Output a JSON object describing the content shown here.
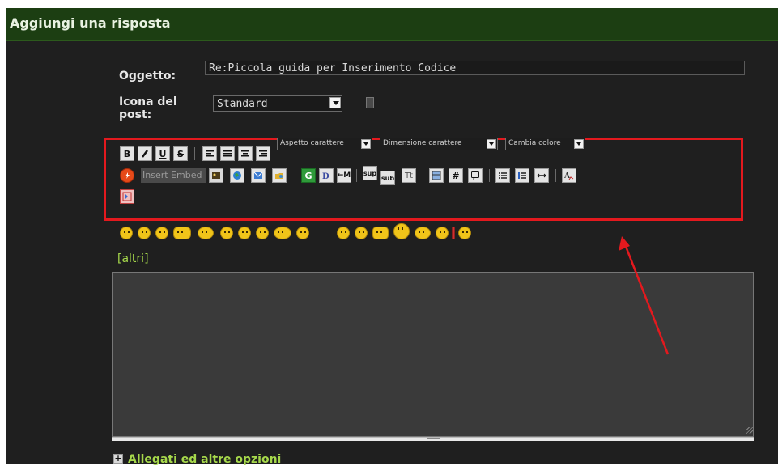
{
  "header": {
    "title": "Aggiungi una risposta"
  },
  "form": {
    "subject_label": "Oggetto:",
    "subject_value": "Re:Piccola guida per Inserimento Codice",
    "icon_label_line1": "Icona del",
    "icon_label_line2": "post:",
    "icon_value": "Standard"
  },
  "toolbar": {
    "font_face_select": "Aspetto carattere",
    "font_size_select": "Dimensione carattere",
    "color_select": "Cambia colore",
    "insert_embed": "Insert Embed",
    "btn_bold": "B",
    "btn_underline": "U",
    "btn_strike": "S",
    "btn_google": "G",
    "btn_sup": "sup",
    "btn_sub": "sub",
    "btn_tt": "Tt",
    "btn_hash": "#",
    "btn_move": "←M"
  },
  "smileys": {
    "more_link": "[altri]"
  },
  "attachments": {
    "toggle_label": "Allegati ed altre opzioni"
  },
  "colors": {
    "background": "#1f1f1f",
    "header_bg": "#1c3e12",
    "link_green": "#a6d84b",
    "highlight_red": "#e3191e"
  }
}
